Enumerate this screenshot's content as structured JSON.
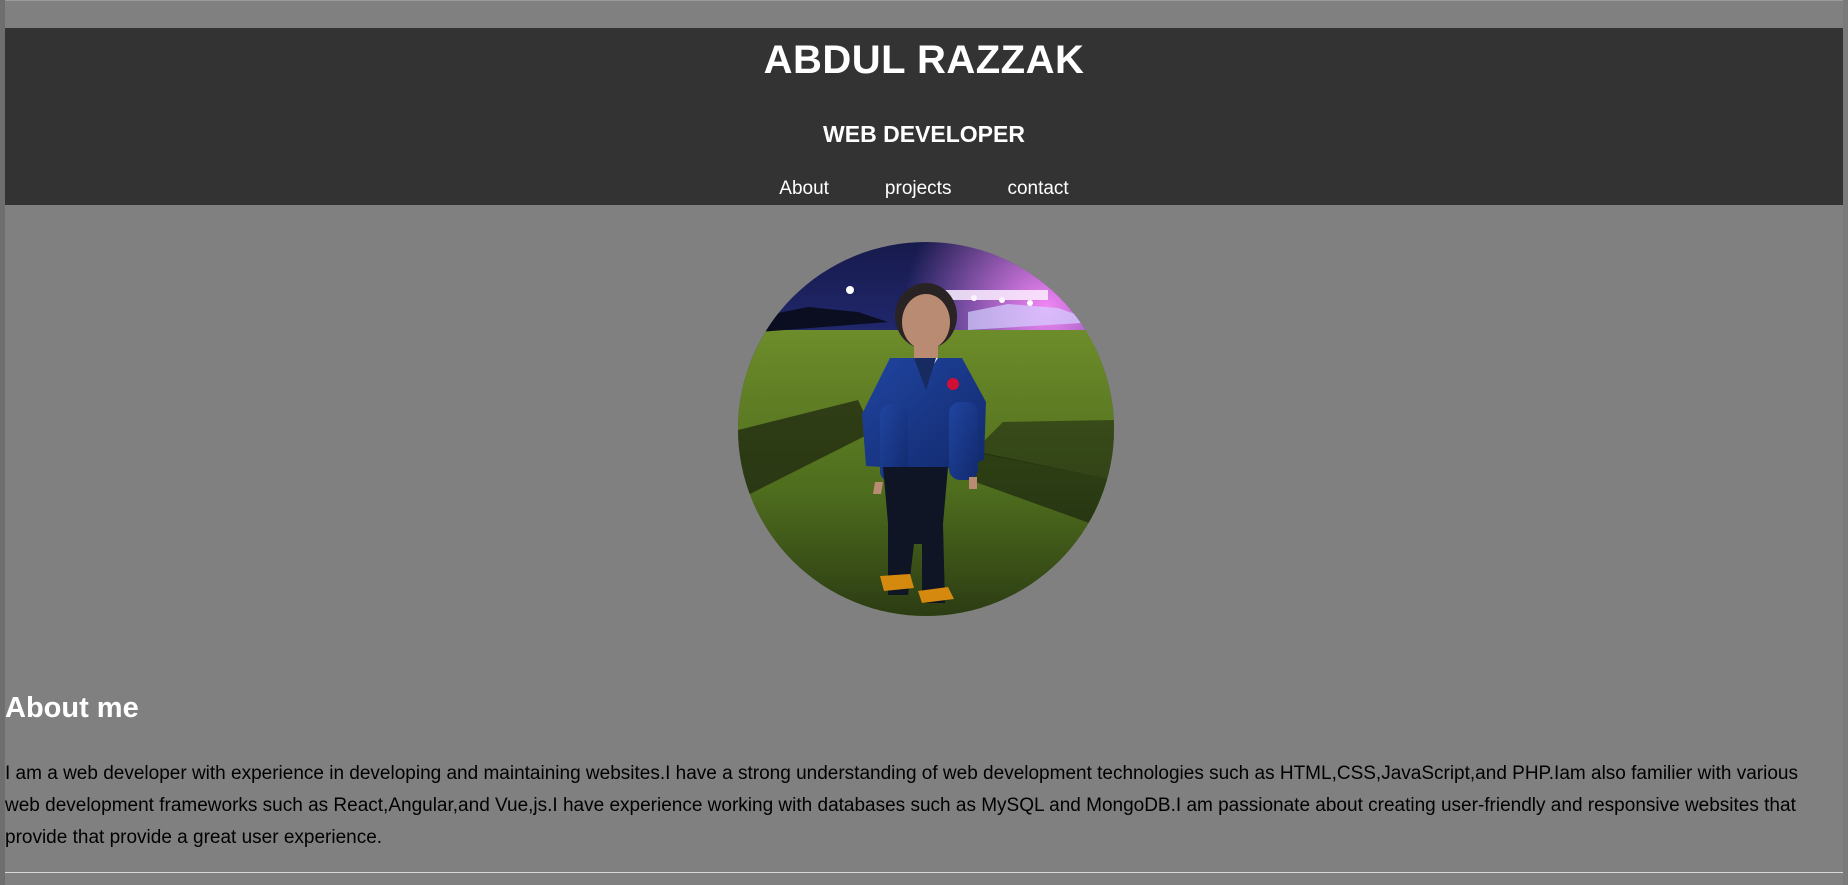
{
  "header": {
    "title": "ABDUL RAZZAK",
    "subtitle": "WEB DEVELOPER",
    "nav": [
      {
        "label": "About"
      },
      {
        "label": "projects"
      },
      {
        "label": "contact"
      }
    ]
  },
  "about": {
    "heading": "About me",
    "text": "I am a web developer with experience in developing and maintaining websites.I have a strong understanding of web development technologies such as HTML,CSS,JavaScript,and PHP.Iam also familier with various web development frameworks such as React,Angular,and Vue,js.I have experience working with databases such as MySQL and MongoDB.I am passionate about creating user-friendly and responsive websites that provide that provide a great user experience."
  },
  "colors": {
    "page_background": "#808080",
    "header_background": "#333333",
    "header_text": "#ffffff",
    "body_text": "#000000"
  }
}
